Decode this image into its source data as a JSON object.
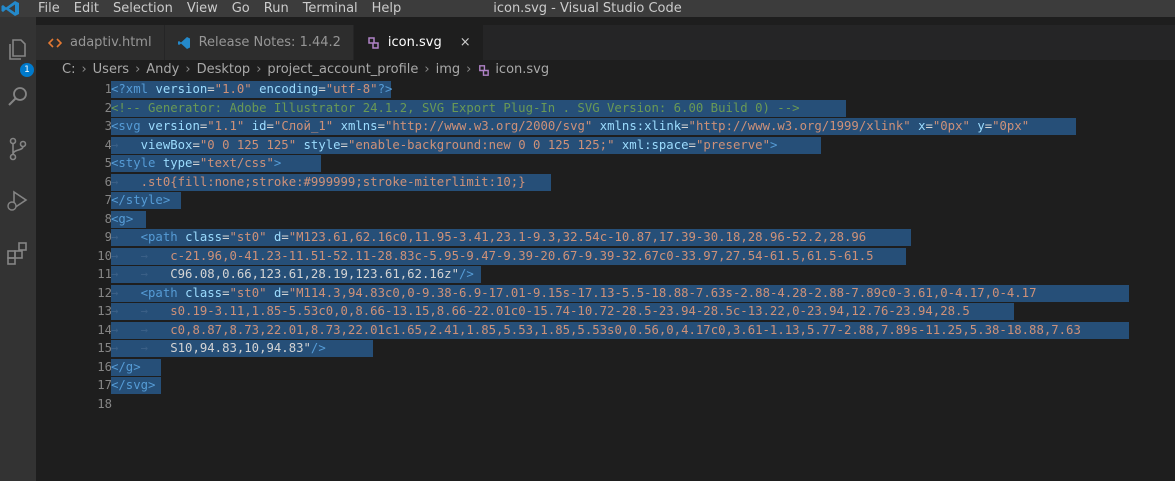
{
  "window": {
    "title": "icon.svg - Visual Studio Code",
    "menu": [
      "File",
      "Edit",
      "Selection",
      "View",
      "Go",
      "Run",
      "Terminal",
      "Help"
    ]
  },
  "activity_bar": {
    "items": [
      "explorer-icon",
      "search-icon",
      "source-control-icon",
      "run-debug-icon",
      "extensions-icon"
    ],
    "explorer_badge": "1"
  },
  "tabs": [
    {
      "label": "adaptiv.html",
      "icon": "html-file-icon",
      "active": false
    },
    {
      "label": "Release Notes: 1.44.2",
      "icon": "vscode-icon",
      "active": false
    },
    {
      "label": "icon.svg",
      "icon": "svg-file-icon",
      "active": true,
      "close": "×"
    }
  ],
  "breadcrumb": [
    "C:",
    "Users",
    "Andy",
    "Desktop",
    "project_account_profile",
    "img",
    "icon.svg"
  ],
  "editor": {
    "line_numbers": [
      "1",
      "2",
      "3",
      "4",
      "5",
      "6",
      "7",
      "8",
      "9",
      "10",
      "11",
      "12",
      "13",
      "14",
      "15",
      "16",
      "17",
      "18"
    ],
    "lines": [
      "<?xml version=\"1.0\" encoding=\"utf-8\"?>",
      "<!-- Generator: Adobe Illustrator 24.1.2, SVG Export Plug-In . SVG Version: 6.00 Build 0) -->",
      "<svg version=\"1.1\" id=\"Слой_1\" xmlns=\"http://www.w3.org/2000/svg\" xmlns:xlink=\"http://www.w3.org/1999/xlink\" x=\"0px\" y=\"0px\"",
      "viewBox=\"0 0 125 125\" style=\"enable-background:new 0 0 125 125;\" xml:space=\"preserve\">",
      "<style type=\"text/css\">",
      ".st0{fill:none;stroke:#999999;stroke-miterlimit:10;}",
      "</style>",
      "<g>",
      "<path class=\"st0\" d=\"M123.61,62.16c0,11.95-3.41,23.1-9.3,32.54c-10.87,17.39-30.18,28.96-52.2,28.96",
      "c-21.96,0-41.23-11.51-52.11-28.83c-5.95-9.47-9.39-20.67-9.39-32.67c0-33.97,27.54-61.5,61.5-61.5",
      "C96.08,0.66,123.61,28.19,123.61,62.16z\"/>",
      "<path class=\"st0\" d=\"M114.3,94.83c0,0-9.38-6.9-17.01-9.15s-17.13-5.5-18.88-7.63s-2.88-4.28-2.88-7.89c0-3.61,0-4.17,0-4.17",
      "s0.19-3.11,1.85-5.53c0,0,8.66-13.15,8.66-22.01c0-15.74-10.72-28.5-23.94-28.5c-13.22,0-23.94,12.76-23.94,28.5",
      "c0,8.87,8.73,22.01,8.73,22.01c1.65,2.41,1.85,5.53,1.85,5.53s0,0.56,0,4.17c0,3.61-1.13,5.77-2.88,7.89s-11.25,5.38-18.88,7.63",
      "S10,94.83,10,94.83\"/>",
      "</g>",
      "</svg>",
      ""
    ]
  },
  "colors": {
    "selection": "#264f78",
    "tag": "#569cd6",
    "attribute": "#9cdcfe",
    "string": "#ce9178",
    "comment": "#6a9955",
    "accent": "#007acc"
  }
}
